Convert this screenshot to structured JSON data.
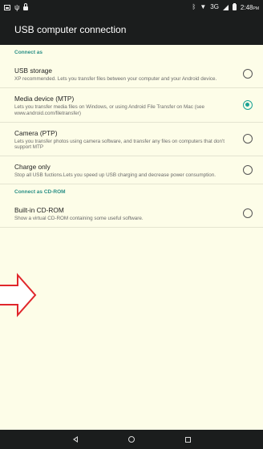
{
  "status_bar": {
    "time": "2:48",
    "time_suffix": "PM",
    "network": "3G",
    "left_icons": [
      "image-icon",
      "usb-icon",
      "lock-icon"
    ],
    "right_icons": [
      "bluetooth-icon",
      "wifi-icon",
      "signal-icon",
      "battery-icon"
    ]
  },
  "app_bar": {
    "title": "USB computer connection"
  },
  "sections": [
    {
      "header": "Connect as",
      "items": [
        {
          "title": "USB storage",
          "desc": "XP recommended. Lets you transfer files between your computer and your Android device.",
          "checked": false
        },
        {
          "title": "Media device (MTP)",
          "desc": "Lets you transfer media files on Windows, or using Android File Transfer on Mac (see www.android.com/filetransfer)",
          "checked": true
        },
        {
          "title": "Camera (PTP)",
          "desc": "Lets you transfer photos using camera software, and transfer any files on computers that don't support MTP",
          "checked": false
        },
        {
          "title": "Charge only",
          "desc": "Stop all USB fuctions.Lets you speed up USB charging and decrease power consumption.",
          "checked": false
        }
      ]
    },
    {
      "header": "Connect as CD-ROM",
      "items": [
        {
          "title": "Built-in CD-ROM",
          "desc": "Show a virtual CD-ROM containing some useful software.",
          "checked": false
        }
      ]
    }
  ],
  "colors": {
    "accent": "#19a295",
    "header_text": "#2a8f86",
    "bar_bg": "#1b1d1d",
    "page_bg": "#fdfde8",
    "annotation": "#e0262b"
  },
  "nav": {
    "buttons": [
      "back-icon",
      "home-icon",
      "recent-apps-icon"
    ]
  }
}
